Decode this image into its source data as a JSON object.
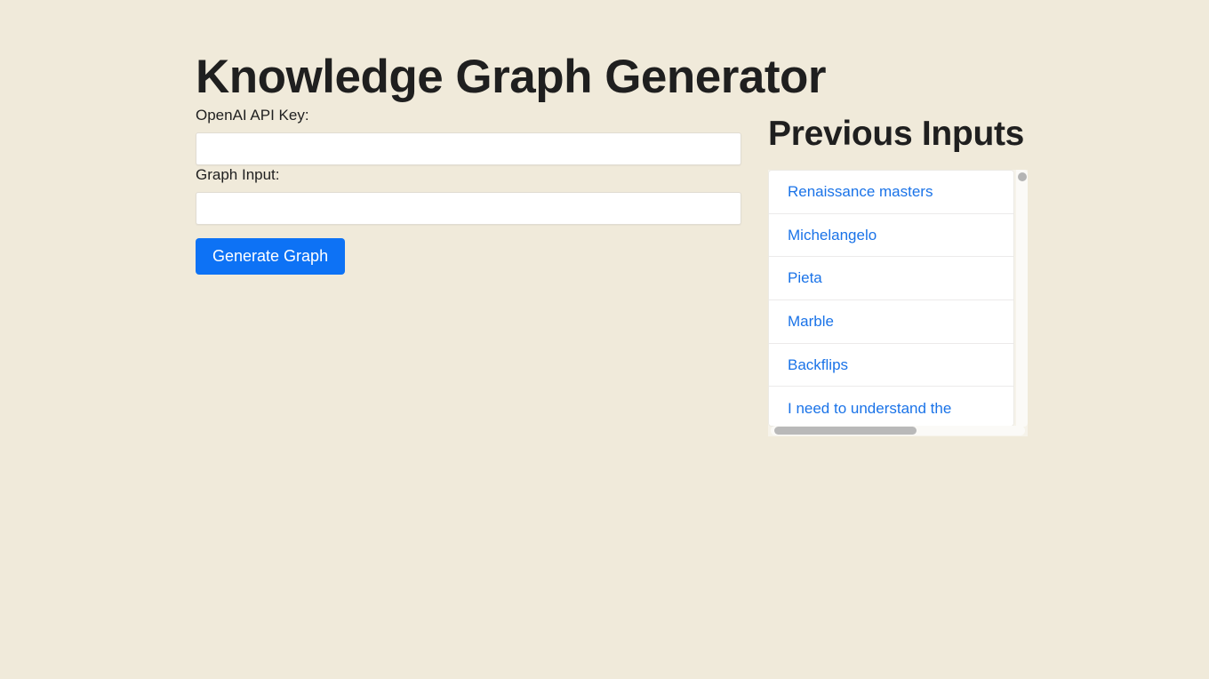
{
  "app": {
    "title": "Knowledge Graph Generator",
    "background_color": "#f0eada",
    "accent_color": "#0d72f5",
    "link_color": "#1a73e8"
  },
  "form": {
    "api_key": {
      "label": "OpenAI API Key:",
      "value": "",
      "placeholder": ""
    },
    "graph_input": {
      "label": "Graph Input:",
      "value": "",
      "placeholder": ""
    },
    "submit_label": "Generate Graph"
  },
  "previous_inputs": {
    "title": "Previous Inputs",
    "items": [
      {
        "label": "Renaissance masters"
      },
      {
        "label": "Michelangelo"
      },
      {
        "label": "Pieta"
      },
      {
        "label": "Marble"
      },
      {
        "label": "Backflips"
      },
      {
        "label": "I need to understand the"
      }
    ]
  }
}
